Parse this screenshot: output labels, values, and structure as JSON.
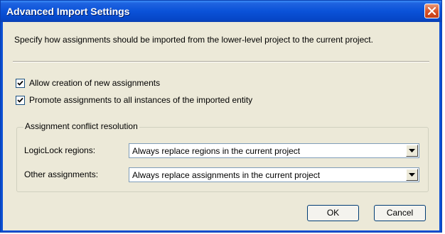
{
  "window": {
    "title": "Advanced Import Settings",
    "close_icon": "close-icon"
  },
  "description": "Specify how assignments should be imported from the lower-level project to the current project.",
  "options": [
    {
      "label": "Allow creation of new assignments",
      "checked": true
    },
    {
      "label": "Promote assignments to all instances of the imported entity",
      "checked": true
    }
  ],
  "conflict_group": {
    "legend": "Assignment conflict resolution",
    "logiclock_label": "LogicLock regions:",
    "logiclock_value": "Always replace regions in the current project",
    "other_label": "Other assignments:",
    "other_value": "Always replace assignments in the current project"
  },
  "buttons": {
    "ok": "OK",
    "cancel": "Cancel"
  }
}
